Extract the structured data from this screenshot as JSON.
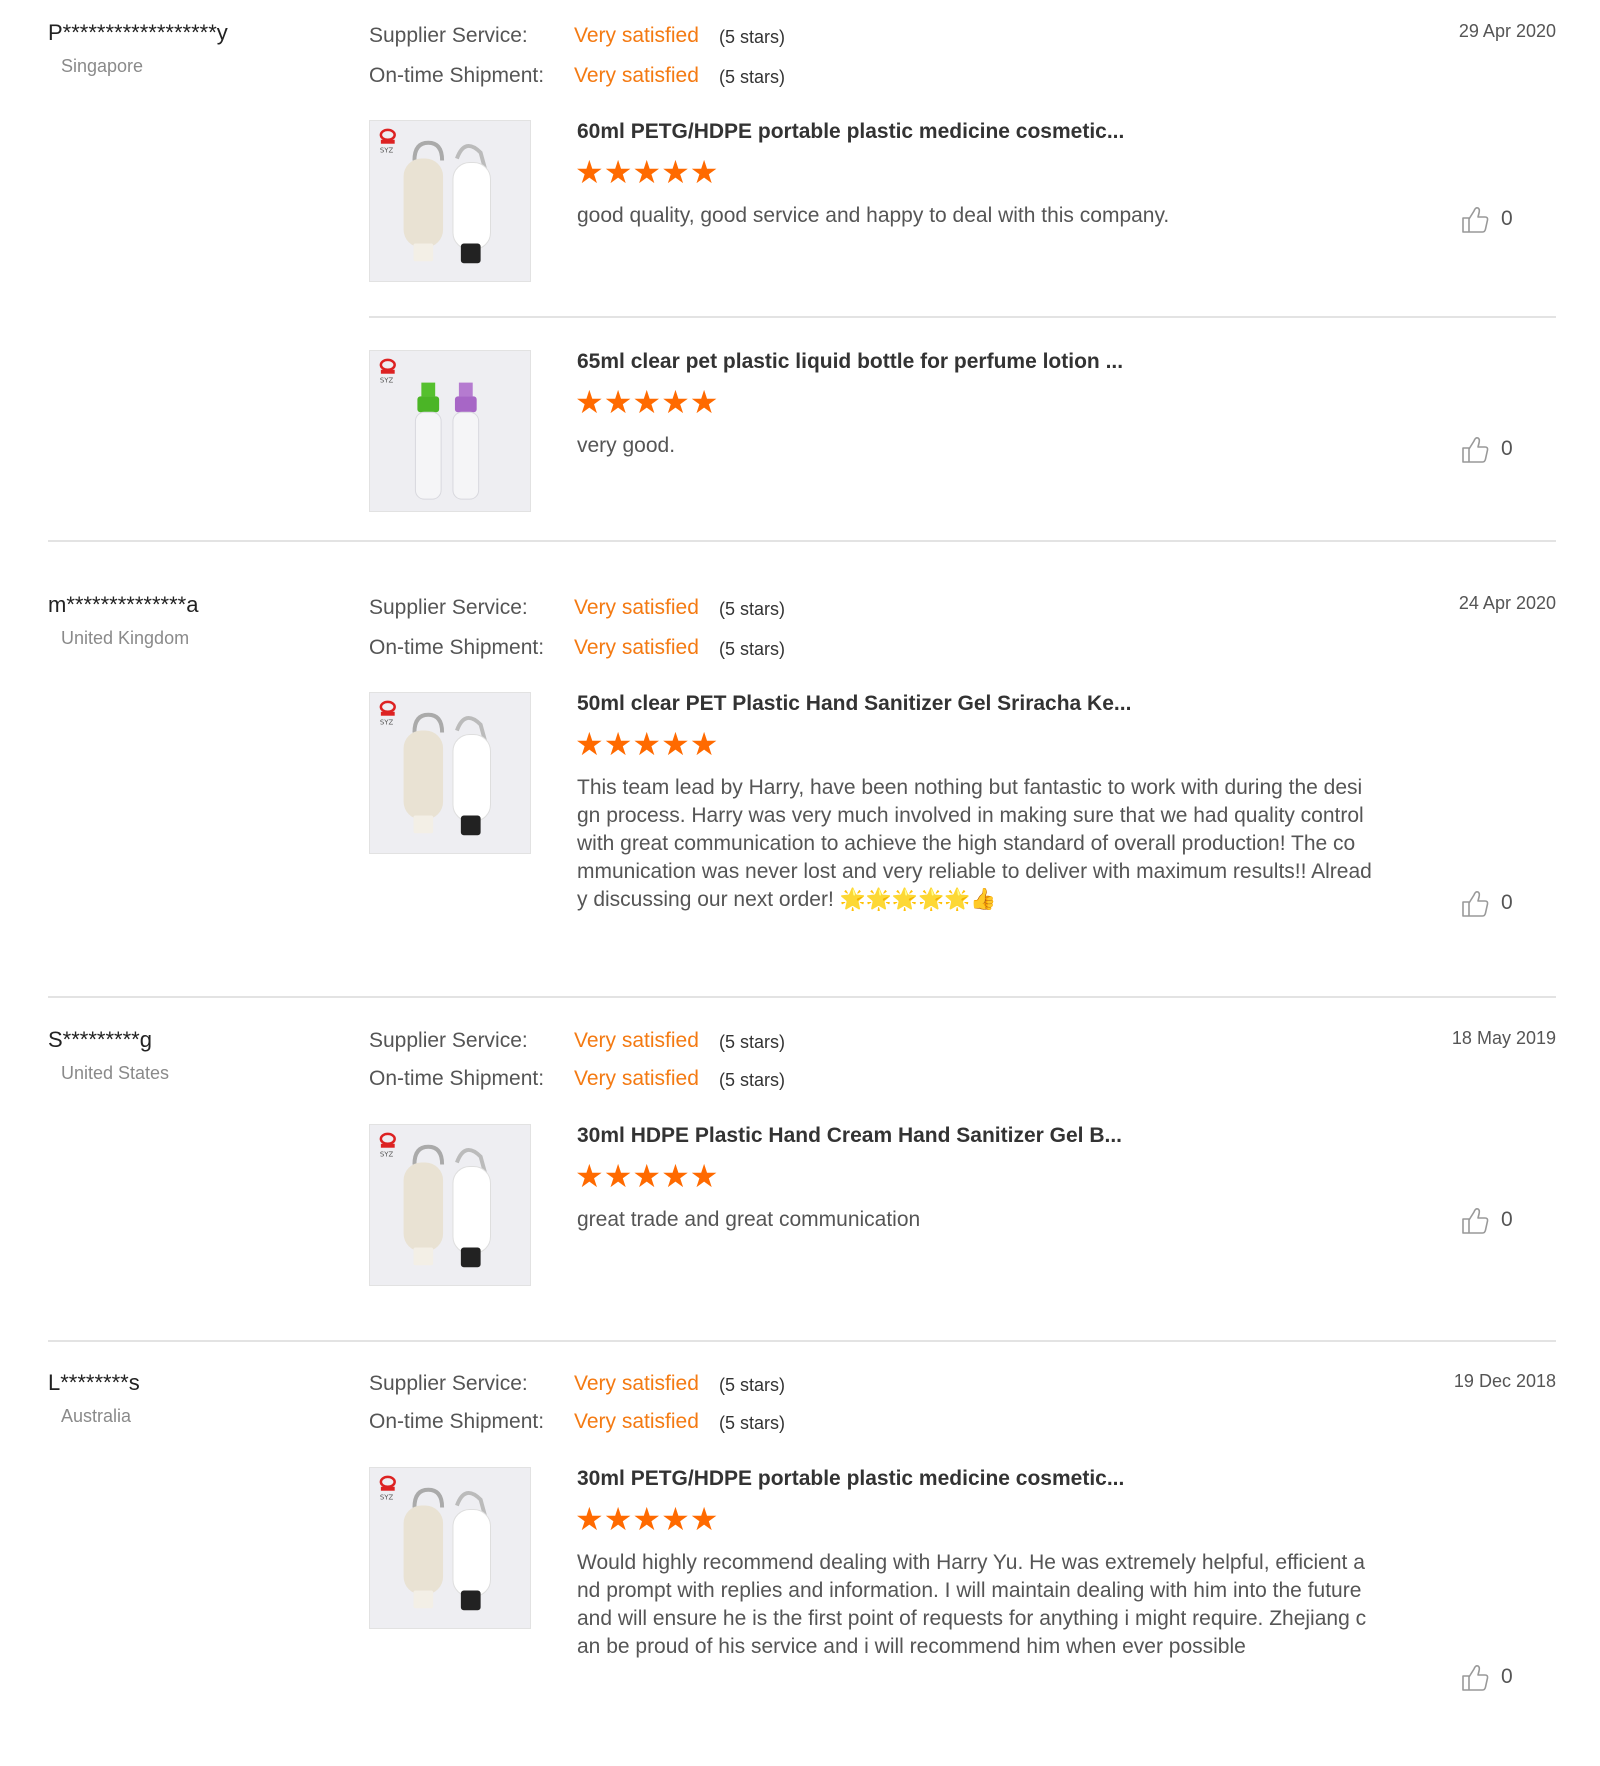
{
  "rating_labels": {
    "supplier_service": "Supplier Service:",
    "ontime_shipment": "On-time Shipment:"
  },
  "colors": {
    "accent": "#f47a12",
    "star": "#ff6a00",
    "divider": "#e3e3e3"
  },
  "reviews": [
    {
      "buyer": "P******************y",
      "country": "Singapore",
      "date": "29 Apr 2020",
      "supplier_service": {
        "value": "Very satisfied",
        "stars": "(5 stars)"
      },
      "ontime_shipment": {
        "value": "Very satisfied",
        "stars": "(5 stars)"
      },
      "items": [
        {
          "title": "60ml PETG/HDPE portable plastic medicine cosmetic...",
          "stars": "★★★★★",
          "rating": 5,
          "comment": "good quality, good service and happy to deal with this company.",
          "likes": "0",
          "image_icon": "carabiner-bottles",
          "logo_text": "SYZ"
        },
        {
          "title": "65ml clear pet plastic liquid bottle for perfume lotion ...",
          "stars": "★★★★★",
          "rating": 5,
          "comment": "very good.",
          "likes": "0",
          "image_icon": "spray-bottles",
          "logo_text": "SYZ"
        }
      ]
    },
    {
      "buyer": "m**************a",
      "country": "United Kingdom",
      "date": "24 Apr 2020",
      "supplier_service": {
        "value": "Very satisfied",
        "stars": "(5 stars)"
      },
      "ontime_shipment": {
        "value": "Very satisfied",
        "stars": "(5 stars)"
      },
      "items": [
        {
          "title": "50ml clear PET Plastic Hand Sanitizer Gel Sriracha Ke...",
          "stars": "★★★★★",
          "rating": 5,
          "comment": "This team lead by Harry, have been nothing but fantastic to work with during the design process. Harry was very much involved in making sure that we had quality control with great communication to achieve the high standard of overall production! The communication was never lost and very reliable to deliver with maximum results!! Already discussing our next order! 🌟🌟🌟🌟🌟👍",
          "likes": "0",
          "image_icon": "carabiner-bottles",
          "logo_text": "SYZ"
        }
      ]
    },
    {
      "buyer": "S*********g",
      "country": "United States",
      "date": "18 May 2019",
      "supplier_service": {
        "value": "Very satisfied",
        "stars": "(5 stars)"
      },
      "ontime_shipment": {
        "value": "Very satisfied",
        "stars": "(5 stars)"
      },
      "items": [
        {
          "title": "30ml HDPE Plastic Hand Cream Hand Sanitizer Gel B...",
          "stars": "★★★★★",
          "rating": 5,
          "comment": "great trade and great communication",
          "likes": "0",
          "image_icon": "carabiner-bottles",
          "logo_text": "SYZ"
        }
      ]
    },
    {
      "buyer": "L********s",
      "country": "Australia",
      "date": "19 Dec 2018",
      "supplier_service": {
        "value": "Very satisfied",
        "stars": "(5 stars)"
      },
      "ontime_shipment": {
        "value": "Very satisfied",
        "stars": "(5 stars)"
      },
      "items": [
        {
          "title": "30ml PETG/HDPE portable plastic medicine cosmetic...",
          "stars": "★★★★★",
          "rating": 5,
          "comment": "Would highly recommend dealing with Harry Yu. He was extremely helpful, efficient and prompt with replies and information. I will maintain dealing with him into the future and will ensure he is the first point of requests for anything i might require. Zhejiang can be proud of his service and i will recommend him when ever possible",
          "likes": "0",
          "image_icon": "carabiner-bottles",
          "logo_text": "SYZ"
        }
      ]
    }
  ]
}
